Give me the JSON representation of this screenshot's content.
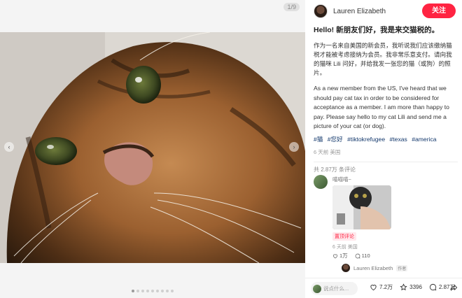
{
  "image_counter": "1/9",
  "author": {
    "name": "Lauren Elizabeth",
    "follow_label": "关注"
  },
  "post": {
    "title": "Hello! 新朋友们好，我是来交猫税的。",
    "desc_cn": "作为一名来自美国的新会员，我听说我们应该缴纳猫税才能被考虑接纳为会员。我非常乐意支付。请向我的猫咪 Lili 问好，并给我发一张您的猫（或狗）的照片。",
    "desc_en": "As a new member from the US, I've heard that we should pay cat tax in order to be considered for acceptance as a member. I am more than happy to pay. Please say hello to my cat Lili and send me a picture of your cat (or dog).",
    "tags": [
      "#猫",
      "#您好",
      "#tiktokrefugee",
      "#texas",
      "#america"
    ],
    "meta": "6 天前 美国",
    "comment_count": "共 2.87万 条评论"
  },
  "comment": {
    "name": "喵喵喵~",
    "badge": "置顶评论",
    "meta": "6 天前 美国",
    "likes": "1万",
    "replies": "110",
    "reply_author": "Lauren Elizabeth",
    "reply_tag": "作者"
  },
  "bottom_bar": {
    "input_placeholder": "说点什么...",
    "likes": "7.2万",
    "collects": "3396",
    "comments": "2.87万"
  },
  "colors": {
    "accent": "#ff2442",
    "tag": "#13386c"
  },
  "icons": {
    "left_arrow": "chevron-left-icon",
    "right_arrow": "chevron-right-icon",
    "like": "heart-icon",
    "collect": "star-icon",
    "comment": "comment-bubble-icon",
    "share": "share-icon"
  }
}
